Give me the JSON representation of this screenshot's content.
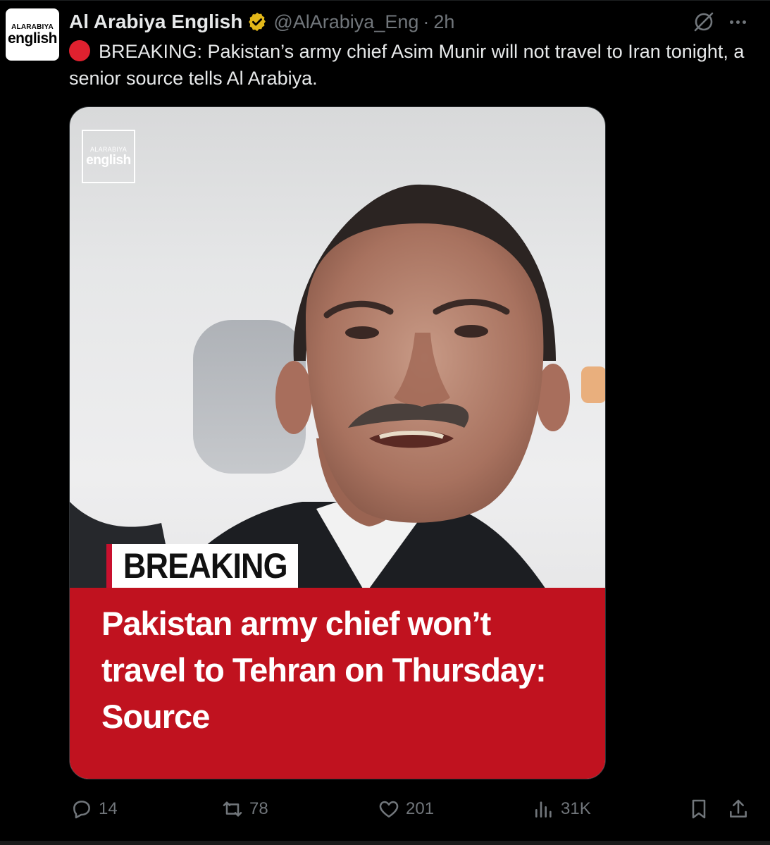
{
  "account": {
    "avatar_top": "ALARABIYA",
    "avatar_bottom": "english",
    "display_name": "Al Arabiya English",
    "handle": "@AlArabiya_Eng",
    "separator": "·",
    "time": "2h",
    "verified_color": "#e2b719"
  },
  "tweet": {
    "text": "BREAKING: Pakistan’s army chief Asim Munir will not travel to Iran tonight, a senior source tells Al Arabiya."
  },
  "media": {
    "logo_top": "ALARABIYA",
    "logo_bottom": "english",
    "tag": "BREAKING",
    "headline": "Pakistan army chief won’t travel to Tehran on Thursday: Source",
    "panel_color": "#c0121f"
  },
  "actions": {
    "replies": "14",
    "reposts": "78",
    "likes": "201",
    "views": "31K"
  },
  "icons": [
    "verified-icon",
    "grok-icon",
    "more-icon",
    "reply-icon",
    "repost-icon",
    "like-icon",
    "views-icon",
    "bookmark-icon",
    "share-icon"
  ]
}
